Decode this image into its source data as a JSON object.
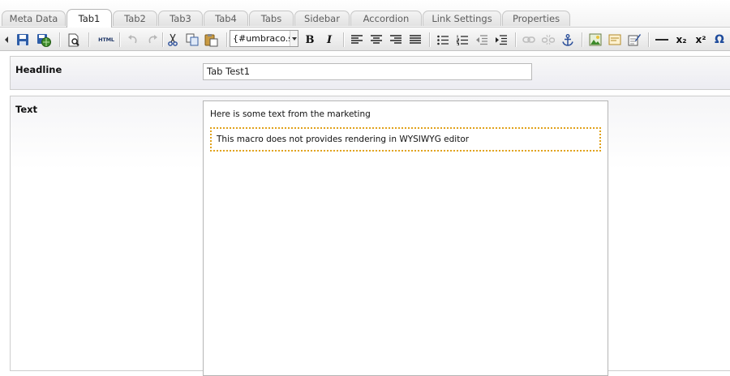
{
  "tabs": [
    {
      "label": "Meta Data",
      "active": false
    },
    {
      "label": "Tab1",
      "active": true
    },
    {
      "label": "Tab2",
      "active": false
    },
    {
      "label": "Tab3",
      "active": false
    },
    {
      "label": "Tab4",
      "active": false
    },
    {
      "label": "Tabs",
      "active": false
    },
    {
      "label": "Sidebar",
      "active": false
    },
    {
      "label": "Accordion",
      "active": false
    },
    {
      "label": "Link Settings",
      "active": false
    },
    {
      "label": "Properties",
      "active": false
    }
  ],
  "toolbar": {
    "html_label": "HTML",
    "bold_label": "B",
    "italic_label": "I",
    "style_select_value": "{#umbraco.styles}",
    "hr_label": "—",
    "subscript_label": "x₂",
    "superscript_label": "x²",
    "charmap_label": "Ω",
    "icons": [
      "toggle-arrow-icon",
      "save-icon",
      "save-publish-icon",
      "preview-icon",
      "html-source-icon",
      "undo-icon",
      "redo-icon",
      "cut-icon",
      "copy-icon",
      "paste-icon",
      "bold-icon",
      "italic-icon",
      "align-left-icon",
      "align-center-icon",
      "align-right-icon",
      "align-justify-icon",
      "bullet-list-icon",
      "numbered-list-icon",
      "outdent-icon",
      "indent-icon",
      "link-icon",
      "unlink-icon",
      "anchor-icon",
      "image-icon",
      "insert-macro-icon",
      "insert-form-icon",
      "horizontal-rule-icon",
      "subscript-icon",
      "superscript-icon",
      "charmap-icon"
    ]
  },
  "properties": {
    "headline": {
      "label": "Headline",
      "value": "Tab Test1"
    },
    "text": {
      "label": "Text",
      "paragraph": "Here is some text from the marketing",
      "macro_message": "This macro does not provides rendering in WYSIWYG editor"
    }
  },
  "colors": {
    "macro_border": "#e1a21b",
    "icon_blue": "#2f5ea8",
    "icon_green": "#3d8a2a"
  }
}
